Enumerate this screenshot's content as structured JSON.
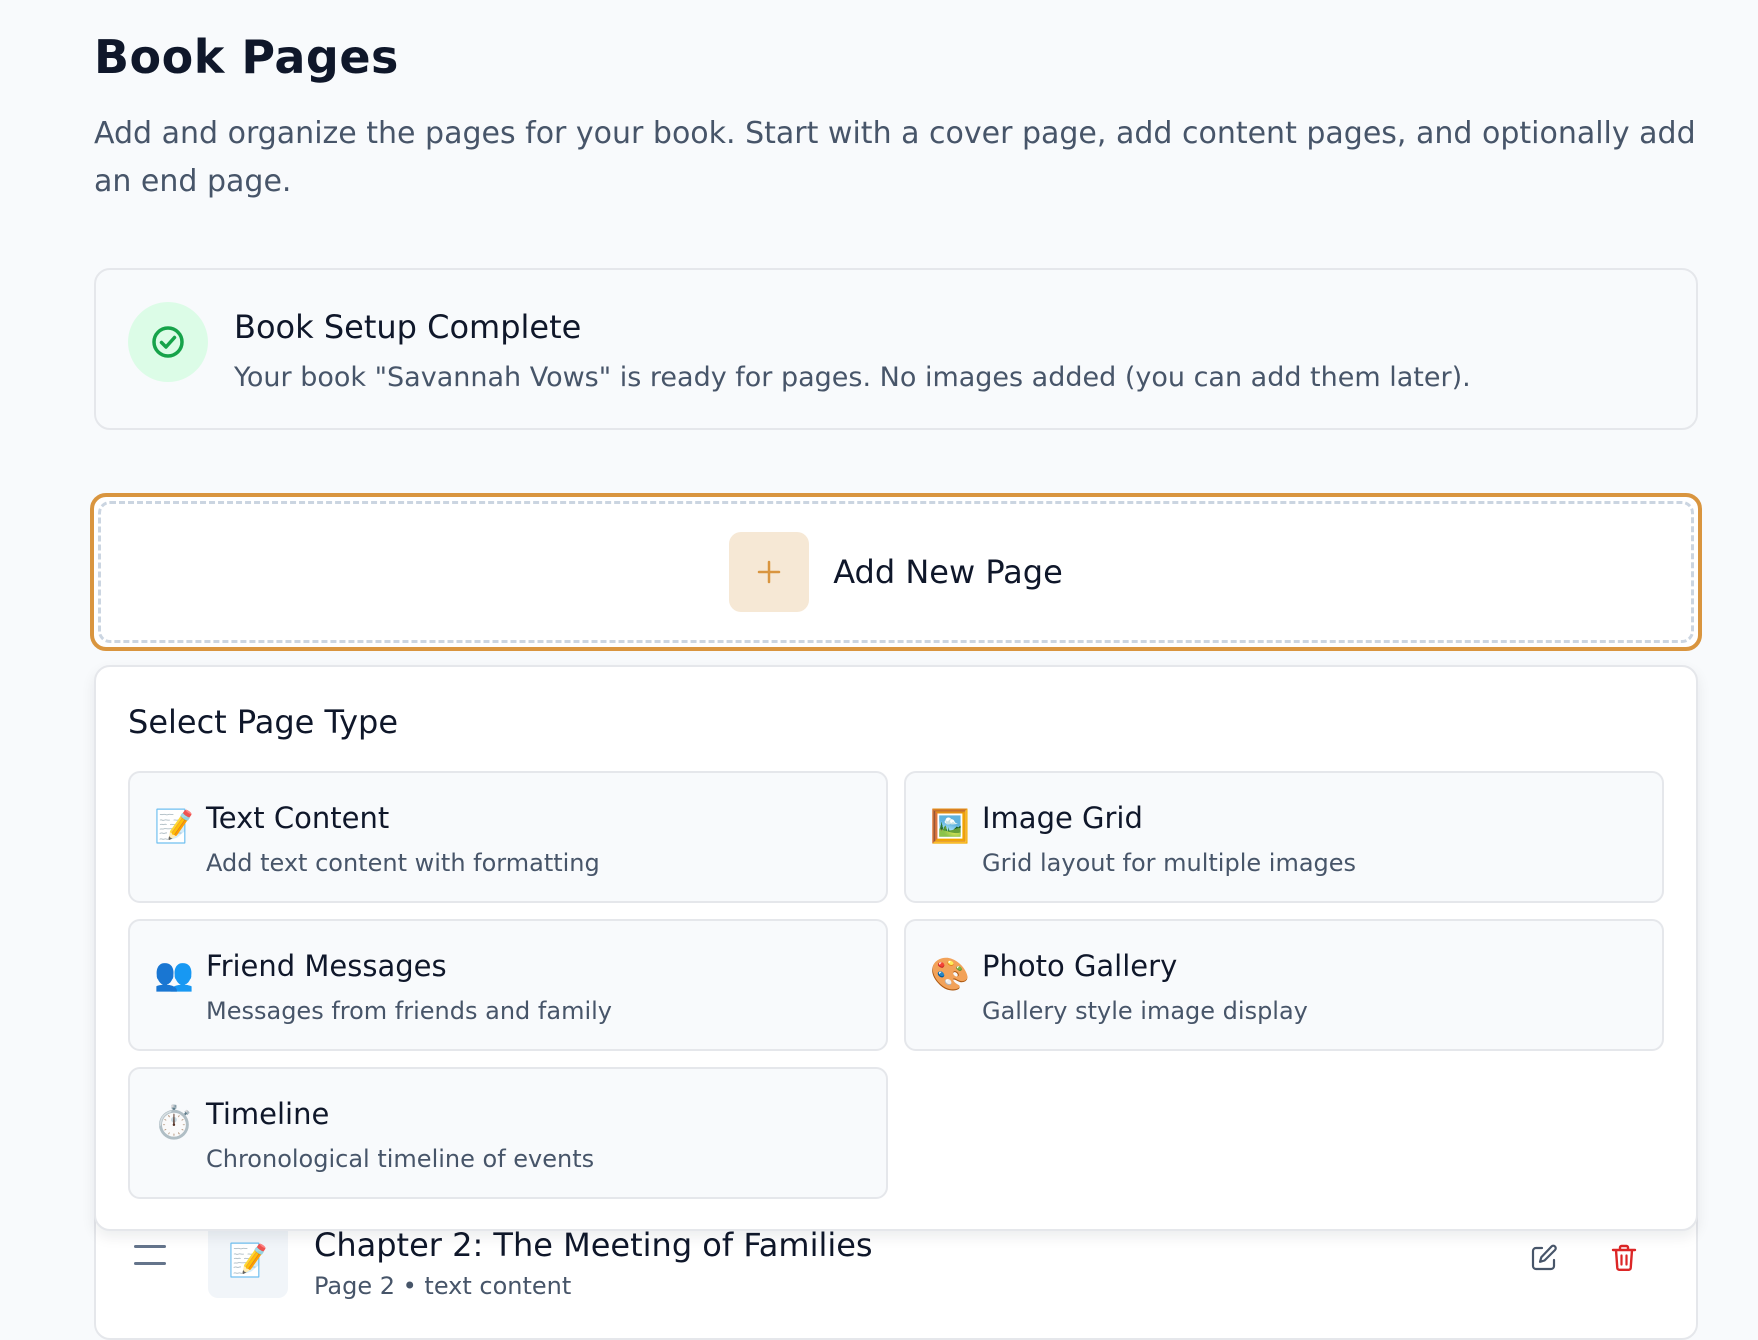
{
  "header": {
    "title": "Book Pages",
    "subtitle": "Add and organize the pages for your book. Start with a cover page, add content pages, and optionally add an end page."
  },
  "setup": {
    "title": "Book Setup Complete",
    "text": "Your book \"Savannah Vows\" is ready for pages. No images added (you can add them later).",
    "icon": "check-circle-icon",
    "accent_color": "#16a34a"
  },
  "add_page": {
    "label": "Add New Page",
    "icon": "plus-icon",
    "accent_color": "#d9953f"
  },
  "page_type_panel": {
    "title": "Select Page Type",
    "options": [
      {
        "icon": "📝",
        "icon_name": "memo-icon",
        "title": "Text Content",
        "description": "Add text content with formatting"
      },
      {
        "icon": "🖼️",
        "icon_name": "framed-picture-icon",
        "title": "Image Grid",
        "description": "Grid layout for multiple images"
      },
      {
        "icon": "👥",
        "icon_name": "people-icon",
        "title": "Friend Messages",
        "description": "Messages from friends and family"
      },
      {
        "icon": "🎨",
        "icon_name": "palette-icon",
        "title": "Photo Gallery",
        "description": "Gallery style image display"
      },
      {
        "icon": "⏱️",
        "icon_name": "stopwatch-icon",
        "title": "Timeline",
        "description": "Chronological timeline of events"
      }
    ]
  },
  "pages_list": {
    "items": [
      {
        "icon": "📝",
        "title": "Chapter 2: The Meeting of Families",
        "meta": "Page 2 • text content"
      }
    ],
    "edit_icon": "edit-icon",
    "delete_icon": "trash-icon",
    "delete_color": "#dc2626"
  }
}
